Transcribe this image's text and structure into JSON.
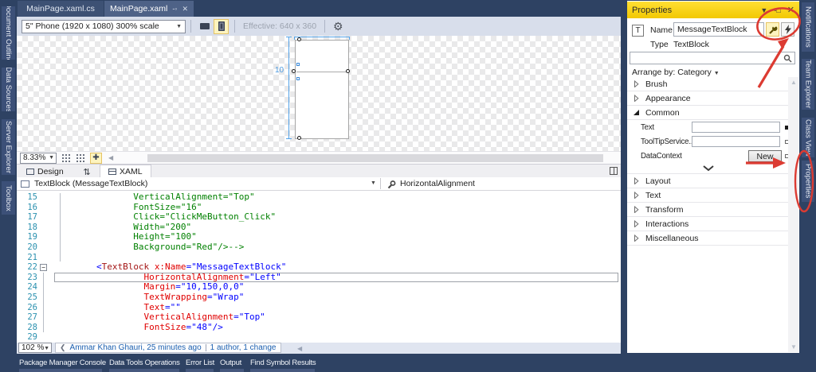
{
  "left_rail": {
    "tabs": [
      "Document Outline",
      "Data Sources",
      "Server Explorer",
      "Toolbox"
    ]
  },
  "right_rail": {
    "tabs": [
      "Notifications",
      "Team Explorer",
      "Class View",
      "Properties"
    ]
  },
  "doc_tabs": [
    {
      "label": "MainPage.xaml.cs",
      "active": false
    },
    {
      "label": "MainPage.xaml",
      "active": true
    }
  ],
  "designer_toolbar": {
    "device_selector": "5\" Phone (1920 x 1080) 300% scale",
    "effective_label": "Effective: 640 x 360"
  },
  "designer": {
    "margin_label": "10",
    "zoom_value": "8.33%"
  },
  "split_tabs": {
    "design_label": "Design",
    "xaml_label": "XAML"
  },
  "breadcrumb": {
    "element": "TextBlock (MessageTextBlock)",
    "member": "HorizontalAlignment"
  },
  "editor": {
    "zoom_value": "102 %",
    "codelens_author": "Ammar Khan Ghauri, 25 minutes ago",
    "codelens_changes": "1 author, 1 change",
    "lines": [
      {
        "n": "15",
        "indent": 15,
        "tokens": [
          [
            "comment",
            "VerticalAlignment=\"Top\""
          ]
        ]
      },
      {
        "n": "16",
        "indent": 15,
        "tokens": [
          [
            "comment",
            "FontSize=\"16\""
          ]
        ]
      },
      {
        "n": "17",
        "indent": 15,
        "tokens": [
          [
            "comment",
            "Click=\"ClickMeButton_Click\""
          ]
        ]
      },
      {
        "n": "18",
        "indent": 15,
        "tokens": [
          [
            "comment",
            "Width=\"200\""
          ]
        ]
      },
      {
        "n": "19",
        "indent": 15,
        "tokens": [
          [
            "comment",
            "Height=\"100\""
          ]
        ]
      },
      {
        "n": "20",
        "indent": 15,
        "tokens": [
          [
            "comment",
            "Background=\"Red\"/>-->"
          ]
        ]
      },
      {
        "n": "21",
        "indent": 0,
        "tokens": []
      },
      {
        "n": "22",
        "indent": 8,
        "tokens": [
          [
            "delim",
            "<"
          ],
          [
            "element",
            "TextBlock"
          ],
          [
            "plain",
            " "
          ],
          [
            "attr",
            "x:Name"
          ],
          [
            "delim",
            "=\""
          ],
          [
            "value",
            "MessageTextBlock"
          ],
          [
            "delim",
            "\""
          ]
        ]
      },
      {
        "n": "23",
        "indent": 17,
        "current": true,
        "tokens": [
          [
            "attr",
            "HorizontalAlignment"
          ],
          [
            "delim",
            "=\""
          ],
          [
            "value",
            "Left"
          ],
          [
            "delim",
            "\""
          ]
        ]
      },
      {
        "n": "24",
        "indent": 17,
        "tokens": [
          [
            "attr",
            "Margin"
          ],
          [
            "delim",
            "=\""
          ],
          [
            "value",
            "10,150,0,0"
          ],
          [
            "delim",
            "\""
          ]
        ]
      },
      {
        "n": "25",
        "indent": 17,
        "tokens": [
          [
            "attr",
            "TextWrapping"
          ],
          [
            "delim",
            "=\""
          ],
          [
            "value",
            "Wrap"
          ],
          [
            "delim",
            "\""
          ]
        ]
      },
      {
        "n": "26",
        "indent": 17,
        "tokens": [
          [
            "attr",
            "Text"
          ],
          [
            "delim",
            "=\"\""
          ]
        ]
      },
      {
        "n": "27",
        "indent": 17,
        "tokens": [
          [
            "attr",
            "VerticalAlignment"
          ],
          [
            "delim",
            "=\""
          ],
          [
            "value",
            "Top"
          ],
          [
            "delim",
            "\""
          ]
        ]
      },
      {
        "n": "28",
        "indent": 17,
        "tokens": [
          [
            "attr",
            "FontSize"
          ],
          [
            "delim",
            "=\""
          ],
          [
            "value",
            "48"
          ],
          [
            "delim",
            "\"/>"
          ]
        ]
      },
      {
        "n": "29",
        "indent": 0,
        "tokens": []
      }
    ]
  },
  "properties_panel": {
    "title": "Properties",
    "name_label": "Name",
    "name_value": "MessageTextBlock",
    "type_label": "Type",
    "type_value": "TextBlock",
    "arrange_label": "Arrange by: Category",
    "new_button": "New",
    "sections_top": [
      "Brush",
      "Appearance"
    ],
    "common_section": "Common",
    "common_rows": [
      {
        "label": "Text",
        "control": "input",
        "marker": "filled"
      },
      {
        "label": "ToolTipService...",
        "control": "input",
        "marker": "empty"
      },
      {
        "label": "DataContext",
        "control": "button",
        "marker": "empty"
      }
    ],
    "sections_bottom": [
      "Layout",
      "Text",
      "Transform",
      "Interactions",
      "Miscellaneous"
    ]
  },
  "bottom_bar": {
    "tabs": [
      "Package Manager Console",
      "Data Tools Operations",
      "Error List",
      "Output",
      "Find Symbol Results"
    ]
  },
  "colors": {
    "navy": "#2E4263",
    "title_yellow": "#F2C802",
    "annotation_red": "#DC3B32",
    "comment_green": "#008000",
    "element_brown": "#A31515",
    "attr_red": "#E00000",
    "value_blue": "#0000FF",
    "lineno_teal": "#2B91AF"
  }
}
